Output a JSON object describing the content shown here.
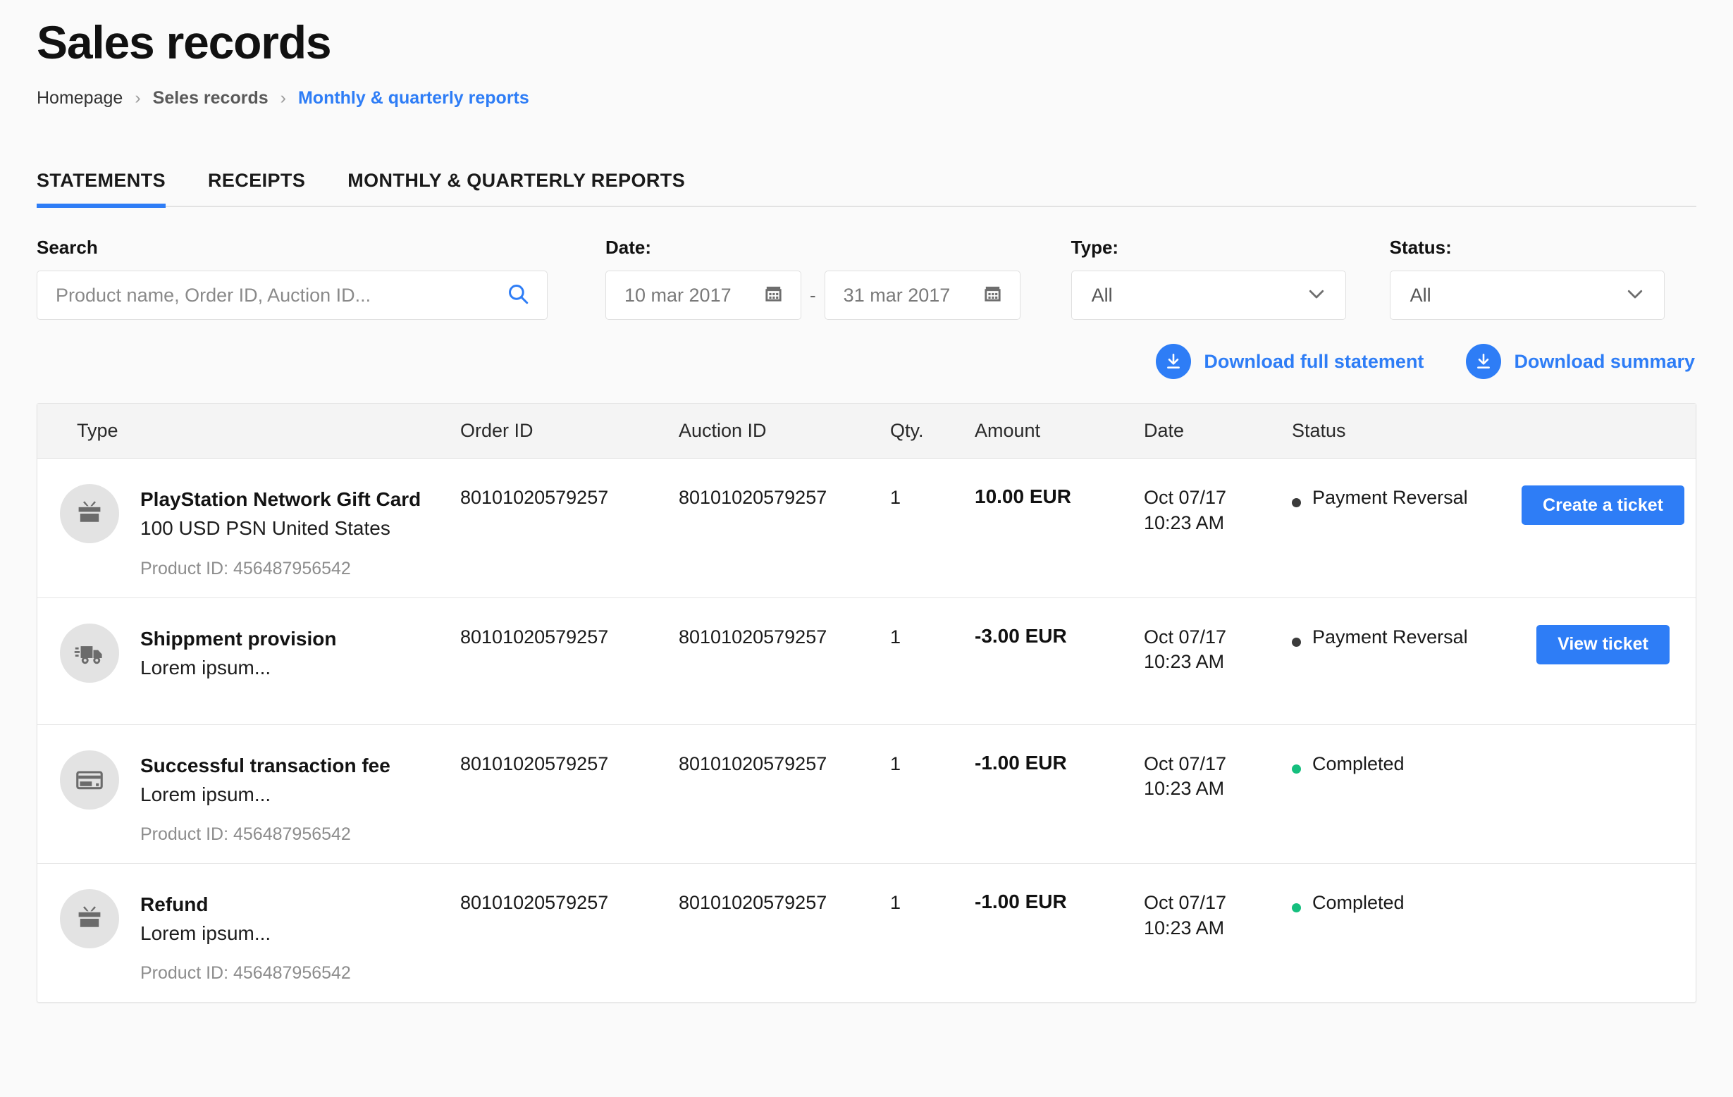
{
  "header": {
    "title": "Sales records",
    "breadcrumb": [
      {
        "label": "Homepage",
        "state": "plain"
      },
      {
        "label": "Seles records",
        "state": "muted"
      },
      {
        "label": "Monthly & quarterly reports",
        "state": "active"
      }
    ],
    "separator": "›"
  },
  "tabs": [
    {
      "label": "STATEMENTS",
      "active": true
    },
    {
      "label": "RECEIPTS",
      "active": false
    },
    {
      "label": "MONTHLY & QUARTERLY REPORTS",
      "active": false
    }
  ],
  "filters": {
    "search": {
      "label": "Search",
      "value": "",
      "placeholder": "Product name, Order ID, Auction ID...",
      "icon": "search-icon"
    },
    "date": {
      "label": "Date:",
      "from": "10 mar 2017",
      "to": "31 mar 2017",
      "separator": "-",
      "icon": "calendar-icon"
    },
    "type": {
      "label": "Type:",
      "value": "All",
      "icon": "chevron-down-icon"
    },
    "status": {
      "label": "Status:",
      "value": "All",
      "icon": "chevron-down-icon"
    }
  },
  "downloads": [
    {
      "label": "Download full statement",
      "icon": "download-icon"
    },
    {
      "label": "Download summary",
      "icon": "download-icon"
    }
  ],
  "table": {
    "columns": [
      "Type",
      "Order ID",
      "Auction ID",
      "Qty.",
      "Amount",
      "Date",
      "Status"
    ],
    "rows": [
      {
        "icon": "gift-card-icon",
        "name": "PlayStation Network Gift Card",
        "subtitle": "100 USD PSN United States",
        "product_id": "Product ID: 456487956542",
        "order_id": "80101020579257",
        "auction_id": "80101020579257",
        "qty": "1",
        "amount": "10.00 EUR",
        "date_day": "Oct 07/17",
        "date_time": "10:23 AM",
        "status": "Payment Reversal",
        "status_color": "gray",
        "action": "Create a ticket"
      },
      {
        "icon": "shipping-truck-icon",
        "name": "Shippment provision",
        "subtitle": "Lorem ipsum...",
        "product_id": "",
        "order_id": "80101020579257",
        "auction_id": "80101020579257",
        "qty": "1",
        "amount": "-3.00 EUR",
        "date_day": "Oct 07/17",
        "date_time": "10:23 AM",
        "status": "Payment Reversal",
        "status_color": "gray",
        "action": "View ticket"
      },
      {
        "icon": "credit-card-icon",
        "name": "Successful transaction fee",
        "subtitle": "Lorem ipsum...",
        "product_id": "Product ID: 456487956542",
        "order_id": "80101020579257",
        "auction_id": "80101020579257",
        "qty": "1",
        "amount": "-1.00 EUR",
        "date_day": "Oct 07/17",
        "date_time": "10:23 AM",
        "status": "Completed",
        "status_color": "green",
        "action": ""
      },
      {
        "icon": "gift-card-icon",
        "name": "Refund",
        "subtitle": "Lorem ipsum...",
        "product_id": "Product ID: 456487956542",
        "order_id": "80101020579257",
        "auction_id": "80101020579257",
        "qty": "1",
        "amount": "-1.00 EUR",
        "date_day": "Oct 07/17",
        "date_time": "10:23 AM",
        "status": "Completed",
        "status_color": "green",
        "action": ""
      }
    ]
  },
  "colors": {
    "accent": "#2e7df6",
    "status_completed": "#15bf7e",
    "status_reversal": "#3b3b3b",
    "page_bg": "#fafafa"
  }
}
